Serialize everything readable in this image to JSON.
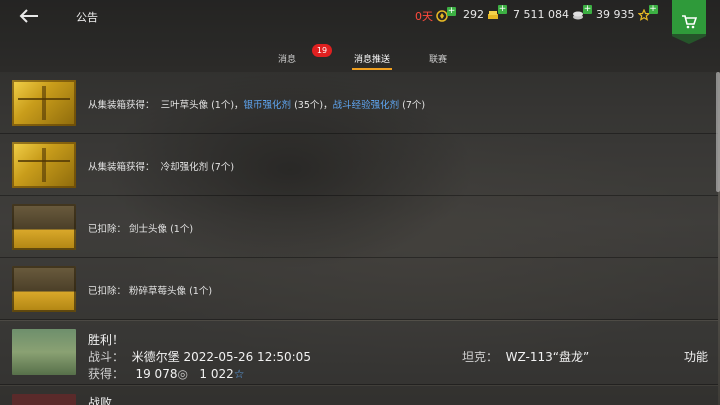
{
  "header": {
    "title": "公告",
    "days": "0天",
    "gold": "292",
    "credits": "7 511 084",
    "free_xp": "39 935"
  },
  "tabs": [
    {
      "label": "消息",
      "badge": "19"
    },
    {
      "label": "消息推送"
    },
    {
      "label": "联赛"
    }
  ],
  "messages": [
    {
      "prefix": "从集装箱获得：",
      "part1": "三叶草头像 (1个)，",
      "link1": "银币强化剂",
      "part2": " (35个)，",
      "link2": "战斗经验强化剂",
      "part3": " (7个)"
    },
    {
      "prefix": "从集装箱获得：",
      "text": "冷却强化剂 (7个)"
    },
    {
      "prefix": "已扣除：",
      "text": "剑士头像 (1个)"
    },
    {
      "prefix": "已扣除：",
      "text": "粉碎草莓头像 (1个)"
    }
  ],
  "battle": {
    "result": "胜利！",
    "battle_label": "战斗：",
    "map": "米德尔堡",
    "datetime": "2022-05-26 12:50:05",
    "tank_label": "坦克：",
    "tank": "WZ-113“盘龙”",
    "function_label": "功能",
    "earned_label": "获得：",
    "credits_earned": "19 078",
    "xp_earned": "1 022"
  },
  "battle2": {
    "result": "战败"
  }
}
